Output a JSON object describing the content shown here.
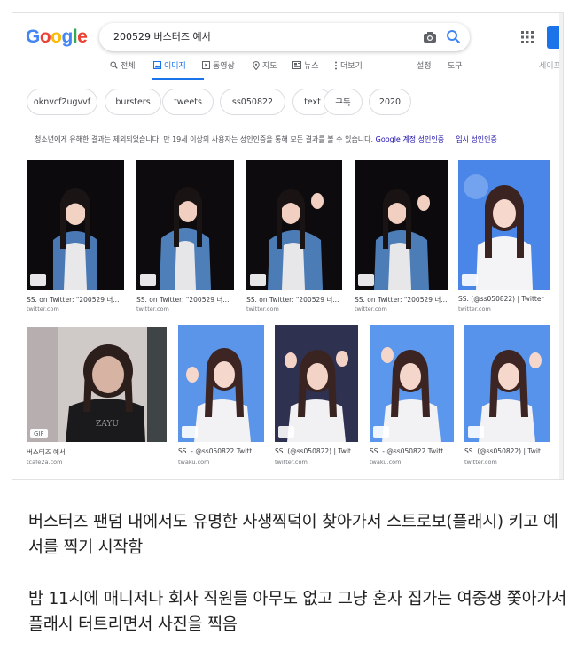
{
  "google": {
    "logo_letters": [
      "G",
      "o",
      "o",
      "g",
      "l",
      "e"
    ],
    "search_value": "200529 버스터즈 예서",
    "tabs": [
      {
        "icon": "search-icon",
        "label": "전체"
      },
      {
        "icon": "image-icon",
        "label": "이미지",
        "active": true
      },
      {
        "icon": "video-icon",
        "label": "동영상"
      },
      {
        "icon": "map-pin-icon",
        "label": "지도"
      },
      {
        "icon": "news-icon",
        "label": "뉴스"
      },
      {
        "icon": "more-icon",
        "label": "더보기"
      }
    ],
    "tools": [
      "설정",
      "도구"
    ],
    "safesearch": "세이프서치",
    "chips": [
      "oknvcf2ugvvf",
      "bursters",
      "tweets",
      "ss050822",
      "text",
      "구독",
      "2020"
    ],
    "notice_text": "청소년에게 유해한 결과는 제외되었습니다. 만 19세 이상의 사용자는 성인인증을 통해 모든 결과를 볼 수 있습니다.",
    "notice_link": "Google 계정 성인인증",
    "notice_link2": "임시 성인인증",
    "row1": [
      {
        "caption": "SS. on Twitter: \"200529 너...",
        "source": "twitter.com"
      },
      {
        "caption": "SS. on Twitter: \"200529 너...",
        "source": "twitter.com"
      },
      {
        "caption": "SS. on Twitter: \"200529 너...",
        "source": "twitter.com"
      },
      {
        "caption": "SS. on Twitter: \"200529 너...",
        "source": "twitter.com"
      },
      {
        "caption": "SS. (@ss050822) | Twitter",
        "source": "twitter.com"
      }
    ],
    "row2": [
      {
        "caption": "버스터즈 예서",
        "source": "tcafe2a.com",
        "gif": "GIF"
      },
      {
        "caption": "SS. - @ss050822 Twitt...",
        "source": "twaku.com"
      },
      {
        "caption": "SS. (@ss050822) | Twit...",
        "source": "twitter.com"
      },
      {
        "caption": "SS. - @ss050822 Twitt...",
        "source": "twaku.com"
      },
      {
        "caption": "SS. (@ss050822) | Twit...",
        "source": "twitter.com"
      }
    ]
  },
  "post": {
    "paragraph1": "버스터즈 팬덤 내에서도 유명한 사생찍덕이 찾아가서 스트로보(플래시) 키고 예서를 찍기 시작함",
    "paragraph2": "밤 11시에 매니저나 회사 직원들 아무도 없고 그냥 혼자 집가는 여중생 쫓아가서 플래시 터트리면서 사진을 찍음"
  },
  "colors": {
    "accent": "#1a73e8",
    "link": "#1a0dab",
    "chip_border": "#dadce0"
  }
}
